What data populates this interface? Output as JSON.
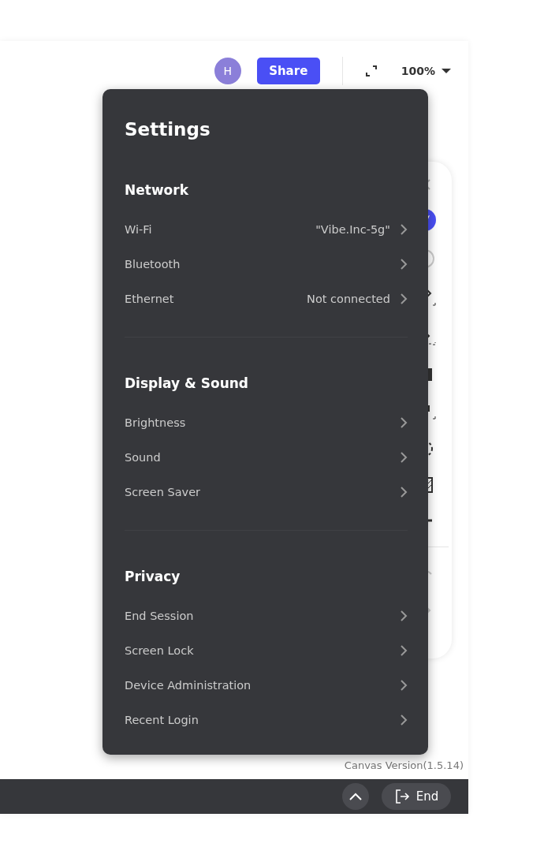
{
  "top_bar": {
    "avatar": "H",
    "share_button": "Share",
    "zoom": "100%"
  },
  "settings": {
    "title": "Settings",
    "sections": [
      {
        "title": "Network",
        "items": [
          {
            "label": "Wi-Fi",
            "value": "\"Vibe.Inc-5g\""
          },
          {
            "label": "Bluetooth"
          },
          {
            "label": "Ethernet",
            "value": "Not connected"
          }
        ]
      },
      {
        "title": "Display & Sound",
        "items": [
          {
            "label": "Brightness"
          },
          {
            "label": "Sound"
          },
          {
            "label": "Screen Saver"
          }
        ]
      },
      {
        "title": "Privacy",
        "items": [
          {
            "label": "End Session"
          },
          {
            "label": "Screen Lock"
          },
          {
            "label": "Device Administration"
          },
          {
            "label": "Recent Login"
          }
        ]
      }
    ]
  },
  "version": "Canvas Version(1.5.14)",
  "bottom_bar": {
    "end_button": "End"
  }
}
